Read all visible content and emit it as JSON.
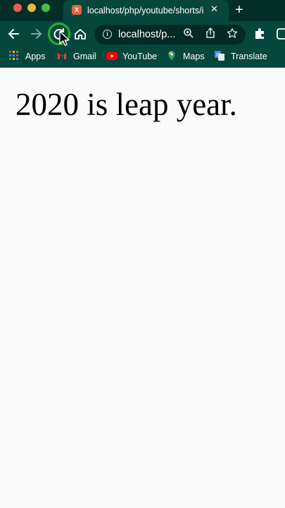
{
  "browser": {
    "tab": {
      "title": "localhost/php/youtube/shorts/i",
      "favicon_letter": "X"
    },
    "address_bar": {
      "url": "localhost/p..."
    },
    "bookmarks": [
      {
        "label": "Apps",
        "icon": "apps-grid-icon"
      },
      {
        "label": "Gmail",
        "icon": "gmail-icon"
      },
      {
        "label": "YouTube",
        "icon": "youtube-icon"
      },
      {
        "label": "Maps",
        "icon": "maps-icon"
      },
      {
        "label": "Translate",
        "icon": "translate-icon"
      }
    ],
    "colors": {
      "toolbar": "#06473d",
      "tabbar": "#032e28",
      "highlight_ring": "#25b22a"
    }
  },
  "page": {
    "heading": "2020 is leap year."
  }
}
